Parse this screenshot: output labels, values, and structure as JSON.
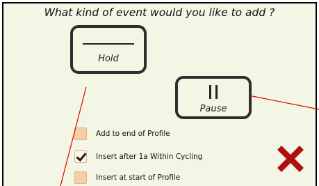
{
  "dialog": {
    "title": "What kind of event would you like to add ?"
  },
  "buttons": {
    "hold_label": "Hold",
    "pause_label": "Pause"
  },
  "options": [
    {
      "label": "Add to end of Profile",
      "checked": false
    },
    {
      "label": "Insert after 1a Within Cycling",
      "checked": true
    },
    {
      "label": "Insert at start of Profile",
      "checked": false
    }
  ],
  "colors": {
    "dialog_background": "#f3f6e4",
    "checkbox_fill": "#f3d0a8",
    "close_icon": "#b01010",
    "annotation_line": "#e00000"
  },
  "icons": {
    "hold": "hold-line-icon",
    "pause": "pause-icon",
    "close": "close-x-icon",
    "check": "checkmark-icon"
  }
}
